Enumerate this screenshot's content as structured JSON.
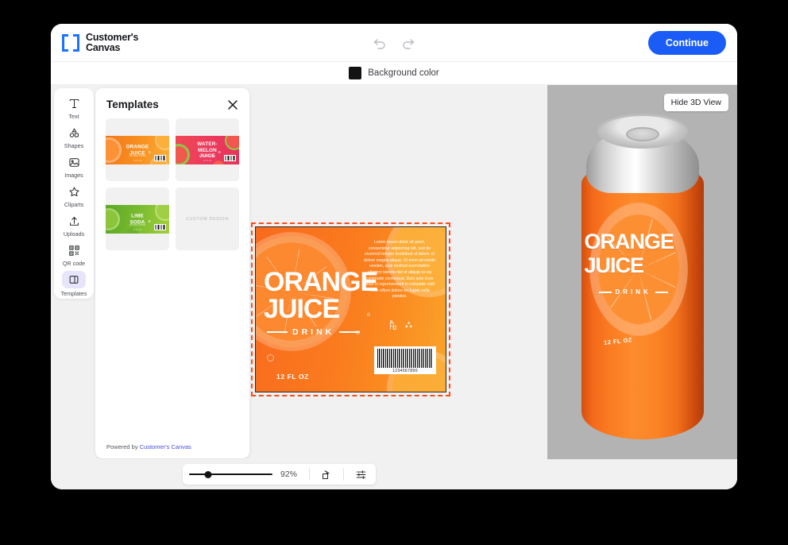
{
  "brand": {
    "name_line1": "Customer's",
    "name_line2": "Canvas",
    "logo_icon": "brackets-logo-icon"
  },
  "topbar": {
    "undo_icon": "undo-icon",
    "redo_icon": "redo-icon",
    "continue_label": "Continue"
  },
  "background_bar": {
    "swatch_color": "#131313",
    "label": "Background color"
  },
  "sidebar": {
    "items": [
      {
        "label": "Text",
        "icon": "text-icon",
        "active": false
      },
      {
        "label": "Shapes",
        "icon": "shapes-icon",
        "active": false
      },
      {
        "label": "Images",
        "icon": "images-icon",
        "active": false
      },
      {
        "label": "Cliparts",
        "icon": "star-icon",
        "active": false
      },
      {
        "label": "Uploads",
        "icon": "upload-icon",
        "active": false
      },
      {
        "label": "QR code",
        "icon": "qr-code-icon",
        "active": false
      },
      {
        "label": "Templates",
        "icon": "templates-icon",
        "active": true
      }
    ]
  },
  "templates_panel": {
    "title": "Templates",
    "close_icon": "close-icon",
    "items": [
      {
        "name": "ORANGE\nJUICE",
        "sub": "NATURAL DRINK",
        "oz": "12 FL OZ",
        "color_from": "#f2781c",
        "color_to": "#f9a02a",
        "type": "label"
      },
      {
        "name": "WATER-\nMELON\nJUICE",
        "sub": "NATURAL DRINK",
        "oz": "12 FL OZ",
        "color_from": "#f0455c",
        "color_to": "#e8315a",
        "type": "label"
      },
      {
        "name": "LIME\nSODA",
        "sub": "NATURAL DRINK",
        "oz": "12 FL OZ",
        "color_from": "#6fb52a",
        "color_to": "#9ccb38",
        "type": "label"
      },
      {
        "name": "CUSTOM DESIGN",
        "type": "custom"
      }
    ],
    "footer_prefix": "Powered by ",
    "footer_link": "Customer's Canvas"
  },
  "canvas": {
    "label": {
      "title_line1": "ORANGE",
      "title_line2": "JUICE",
      "drink": "DRINK",
      "volume": "12 FL OZ",
      "lorem": "Lorem ipsum dolor sit amet, consectetur adipiscing elit, sed do eiusmod tempor incididunt ut labore et dolore magna aliqua. Ut enim ad minim veniam, quis nostrud exercitation ullamco laboris nisi ut aliquip ex ea commodo consequat. Duis aute irure dolor in reprehenderit in voluptate velit esse cillum dolore eu fugiat nulla pariatur.",
      "barcode_number": "1234567890",
      "icons": [
        "trash-bin-icon",
        "recycle-icon"
      ],
      "selection_color": "#ff4a17"
    }
  },
  "view3d": {
    "hide_button_label": "Hide 3D View",
    "background_color": "#b3b3b3",
    "can": {
      "title_line1": "ORANGE",
      "title_line2": "JUICE",
      "drink": "DRINK",
      "volume": "12 FL OZ"
    }
  },
  "bottom_toolbar": {
    "zoom_value": "92%",
    "slider_position_percent": 23,
    "rotate_icon": "rotate-icon",
    "settings_icon": "sliders-icon"
  }
}
